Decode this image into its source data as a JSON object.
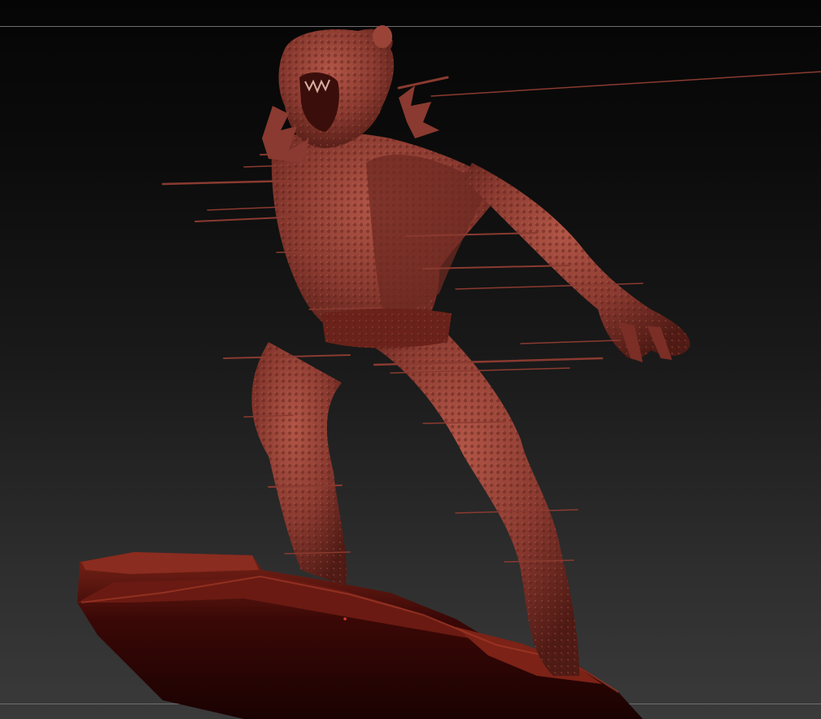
{
  "viewport": {
    "background_top": "#050505",
    "background_bottom": "#3a3a3a",
    "guide_line_color": "#6e6e6e"
  },
  "model": {
    "subject": "sculpted-ape-figure",
    "material_color": "#8a3a30",
    "highlight_color": "#b85a4c",
    "shadow_color": "#3a0e0a",
    "base_color": "#4a0a06",
    "artifact": "horizontal-stretched-polygons"
  }
}
